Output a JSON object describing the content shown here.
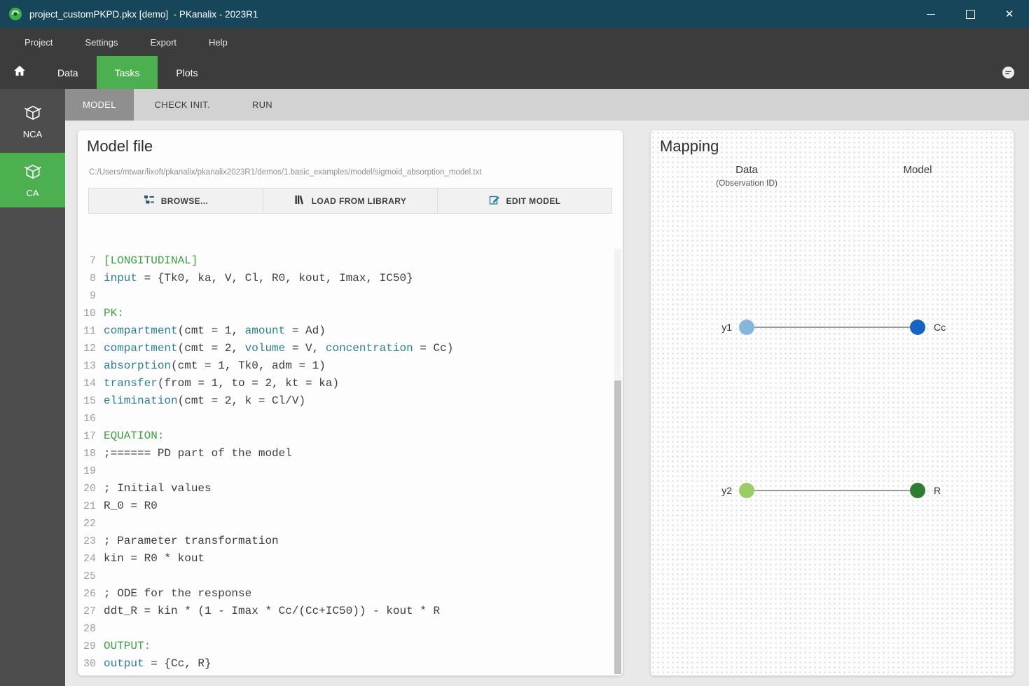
{
  "window": {
    "title": "project_customPKPD.pkx [demo]  - PKanalix - 2023R1"
  },
  "menu": {
    "items": [
      {
        "label": "Project"
      },
      {
        "label": "Settings"
      },
      {
        "label": "Export"
      },
      {
        "label": "Help"
      }
    ]
  },
  "nav": {
    "tabs": [
      {
        "label": "Data",
        "active": false
      },
      {
        "label": "Tasks",
        "active": true
      },
      {
        "label": "Plots",
        "active": false
      }
    ]
  },
  "sidebar": {
    "items": [
      {
        "label": "NCA",
        "active": false
      },
      {
        "label": "CA",
        "active": true
      }
    ]
  },
  "task_tabs": {
    "tabs": [
      {
        "label": "MODEL",
        "active": true
      },
      {
        "label": "CHECK INIT.",
        "active": false
      },
      {
        "label": "RUN",
        "active": false
      }
    ]
  },
  "model_file": {
    "title": "Model file",
    "path": "C:/Users/mtwar/lixoft/pkanalix/pkanalix2023R1/demos/1.basic_examples/model/sigmoid_absorption_model.txt",
    "browse_label": "BROWSE...",
    "load_label": "LOAD FROM LIBRARY",
    "edit_label": "EDIT MODEL"
  },
  "editor": {
    "lines": [
      {
        "num": 7,
        "segments": [
          {
            "t": "s",
            "x": "[LONGITUDINAL]"
          }
        ]
      },
      {
        "num": 8,
        "segments": [
          {
            "t": "f",
            "x": "input"
          },
          {
            "t": "p",
            "x": " = {Tk0, ka, V, Cl, R0, kout, Imax, IC50}"
          }
        ]
      },
      {
        "num": 9,
        "segments": []
      },
      {
        "num": 10,
        "segments": [
          {
            "t": "s",
            "x": "PK:"
          }
        ]
      },
      {
        "num": 11,
        "segments": [
          {
            "t": "f",
            "x": "compartment"
          },
          {
            "t": "p",
            "x": "(cmt = 1, "
          },
          {
            "t": "f",
            "x": "amount"
          },
          {
            "t": "p",
            "x": " = Ad)"
          }
        ]
      },
      {
        "num": 12,
        "segments": [
          {
            "t": "f",
            "x": "compartment"
          },
          {
            "t": "p",
            "x": "(cmt = 2, "
          },
          {
            "t": "f",
            "x": "volume"
          },
          {
            "t": "p",
            "x": " = V, "
          },
          {
            "t": "f",
            "x": "concentration"
          },
          {
            "t": "p",
            "x": " = Cc)"
          }
        ]
      },
      {
        "num": 13,
        "segments": [
          {
            "t": "f",
            "x": "absorption"
          },
          {
            "t": "p",
            "x": "(cmt = 1, Tk0, adm = 1)"
          }
        ]
      },
      {
        "num": 14,
        "segments": [
          {
            "t": "f",
            "x": "transfer"
          },
          {
            "t": "p",
            "x": "(from = 1, to = 2, kt = ka)"
          }
        ]
      },
      {
        "num": 15,
        "segments": [
          {
            "t": "f",
            "x": "elimination"
          },
          {
            "t": "p",
            "x": "(cmt = 2, k = Cl/V)"
          }
        ]
      },
      {
        "num": 16,
        "segments": []
      },
      {
        "num": 17,
        "segments": [
          {
            "t": "s",
            "x": "EQUATION:"
          }
        ]
      },
      {
        "num": 18,
        "segments": [
          {
            "t": "p",
            "x": ";====== PD part of the model"
          }
        ]
      },
      {
        "num": 19,
        "segments": []
      },
      {
        "num": 20,
        "segments": [
          {
            "t": "p",
            "x": "; Initial values"
          }
        ]
      },
      {
        "num": 21,
        "segments": [
          {
            "t": "p",
            "x": "R_0 = R0"
          }
        ]
      },
      {
        "num": 22,
        "segments": []
      },
      {
        "num": 23,
        "segments": [
          {
            "t": "p",
            "x": "; Parameter transformation"
          }
        ]
      },
      {
        "num": 24,
        "segments": [
          {
            "t": "p",
            "x": "kin = R0 * kout"
          }
        ]
      },
      {
        "num": 25,
        "segments": []
      },
      {
        "num": 26,
        "segments": [
          {
            "t": "p",
            "x": "; ODE for the response"
          }
        ]
      },
      {
        "num": 27,
        "segments": [
          {
            "t": "p",
            "x": "ddt_R = kin * (1 - Imax * Cc/(Cc+IC50)) - kout * R"
          }
        ]
      },
      {
        "num": 28,
        "segments": []
      },
      {
        "num": 29,
        "segments": [
          {
            "t": "s",
            "x": "OUTPUT:"
          }
        ]
      },
      {
        "num": 30,
        "segments": [
          {
            "t": "f",
            "x": "output"
          },
          {
            "t": "p",
            "x": " = {Cc, R}"
          }
        ]
      }
    ]
  },
  "mapping": {
    "title": "Mapping",
    "data_header": "Data",
    "data_subheader": "(Observation ID)",
    "model_header": "Model",
    "rows": [
      {
        "data_label": "y1",
        "model_label": "Cc",
        "data_color": "#85b7dd",
        "model_color": "#1565c0"
      },
      {
        "data_label": "y2",
        "model_label": "R",
        "data_color": "#9ccc65",
        "model_color": "#2e7d32"
      }
    ]
  },
  "colors": {
    "accent_green": "#4caf50",
    "titlebar": "#17465a"
  }
}
